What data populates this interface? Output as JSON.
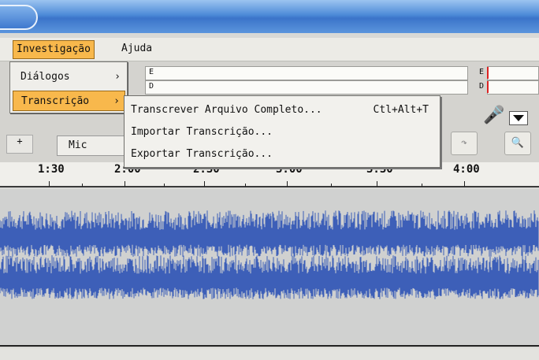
{
  "menubar": {
    "investigacao": "Investigação",
    "ajuda": "Ajuda"
  },
  "menu": {
    "dialogos": "Diálogos",
    "transcricao": "Transcrição"
  },
  "submenu": {
    "items": [
      {
        "label": "Transcrever Arquivo Completo...",
        "shortcut": "Ctl+Alt+T"
      },
      {
        "label": "Importar Transcrição...",
        "shortcut": ""
      },
      {
        "label": "Exportar Transcrição...",
        "shortcut": ""
      }
    ]
  },
  "meters": {
    "left_label": "E",
    "right_label": "D"
  },
  "toolbar": {
    "input_source": "Mic",
    "plus": "+",
    "mic_icon": "microphone-icon",
    "redo_icon": "redo-icon",
    "zoom_icon": "zoom-in-icon"
  },
  "ruler": {
    "labels": [
      "1:30",
      "2:00",
      "2:30",
      "3:00",
      "3:30",
      "4:00"
    ]
  },
  "colors": {
    "accent": "#f8b84c",
    "waveform": "#3d5fb8",
    "title": "#4d8bd8"
  }
}
